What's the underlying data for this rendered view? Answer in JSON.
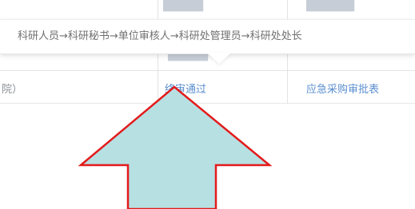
{
  "tooltip": {
    "text": "科研人员→科研秘书→单位审核人→科研处管理员→科研处处长"
  },
  "table": {
    "row": {
      "first_cell_text": "院）",
      "status_text": "终审通过",
      "form_text": "应急采购审批表"
    }
  },
  "annotation": {
    "arrow_icon": "up-arrow-icon",
    "fill_color": "#b7e0e3",
    "stroke_color": "#e31b1b"
  },
  "colors": {
    "link": "#5b8fd0",
    "tooltip_text": "#707070",
    "grid": "#e3e3e3"
  }
}
